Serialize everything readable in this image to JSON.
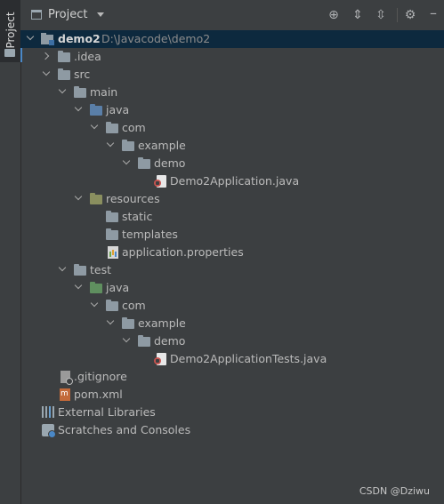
{
  "tool_window": {
    "side_tab_label": "Project",
    "title": "Project",
    "toolbar": {
      "locate_icon": "crosshair-icon",
      "expand_all_icon": "expand-all-icon",
      "collapse_all_icon": "collapse-all-icon",
      "settings_icon": "gear-icon",
      "hide_icon": "minimize-icon"
    }
  },
  "tree": {
    "root": {
      "name": "demo2",
      "path": "D:\\Javacode\\demo2"
    },
    "idea": ".idea",
    "src": "src",
    "main": "main",
    "main_java": "java",
    "main_com": "com",
    "main_example": "example",
    "main_demo": "demo",
    "main_app": "Demo2Application.java",
    "resources": "resources",
    "static": "static",
    "templates": "templates",
    "app_props": "application.properties",
    "test": "test",
    "test_java": "java",
    "test_com": "com",
    "test_example": "example",
    "test_demo": "demo",
    "test_app": "Demo2ApplicationTests.java",
    "gitignore": ".gitignore",
    "pom": "pom.xml",
    "external_libraries": "External Libraries",
    "scratches": "Scratches and Consoles"
  },
  "watermark": "CSDN @Dziwu"
}
